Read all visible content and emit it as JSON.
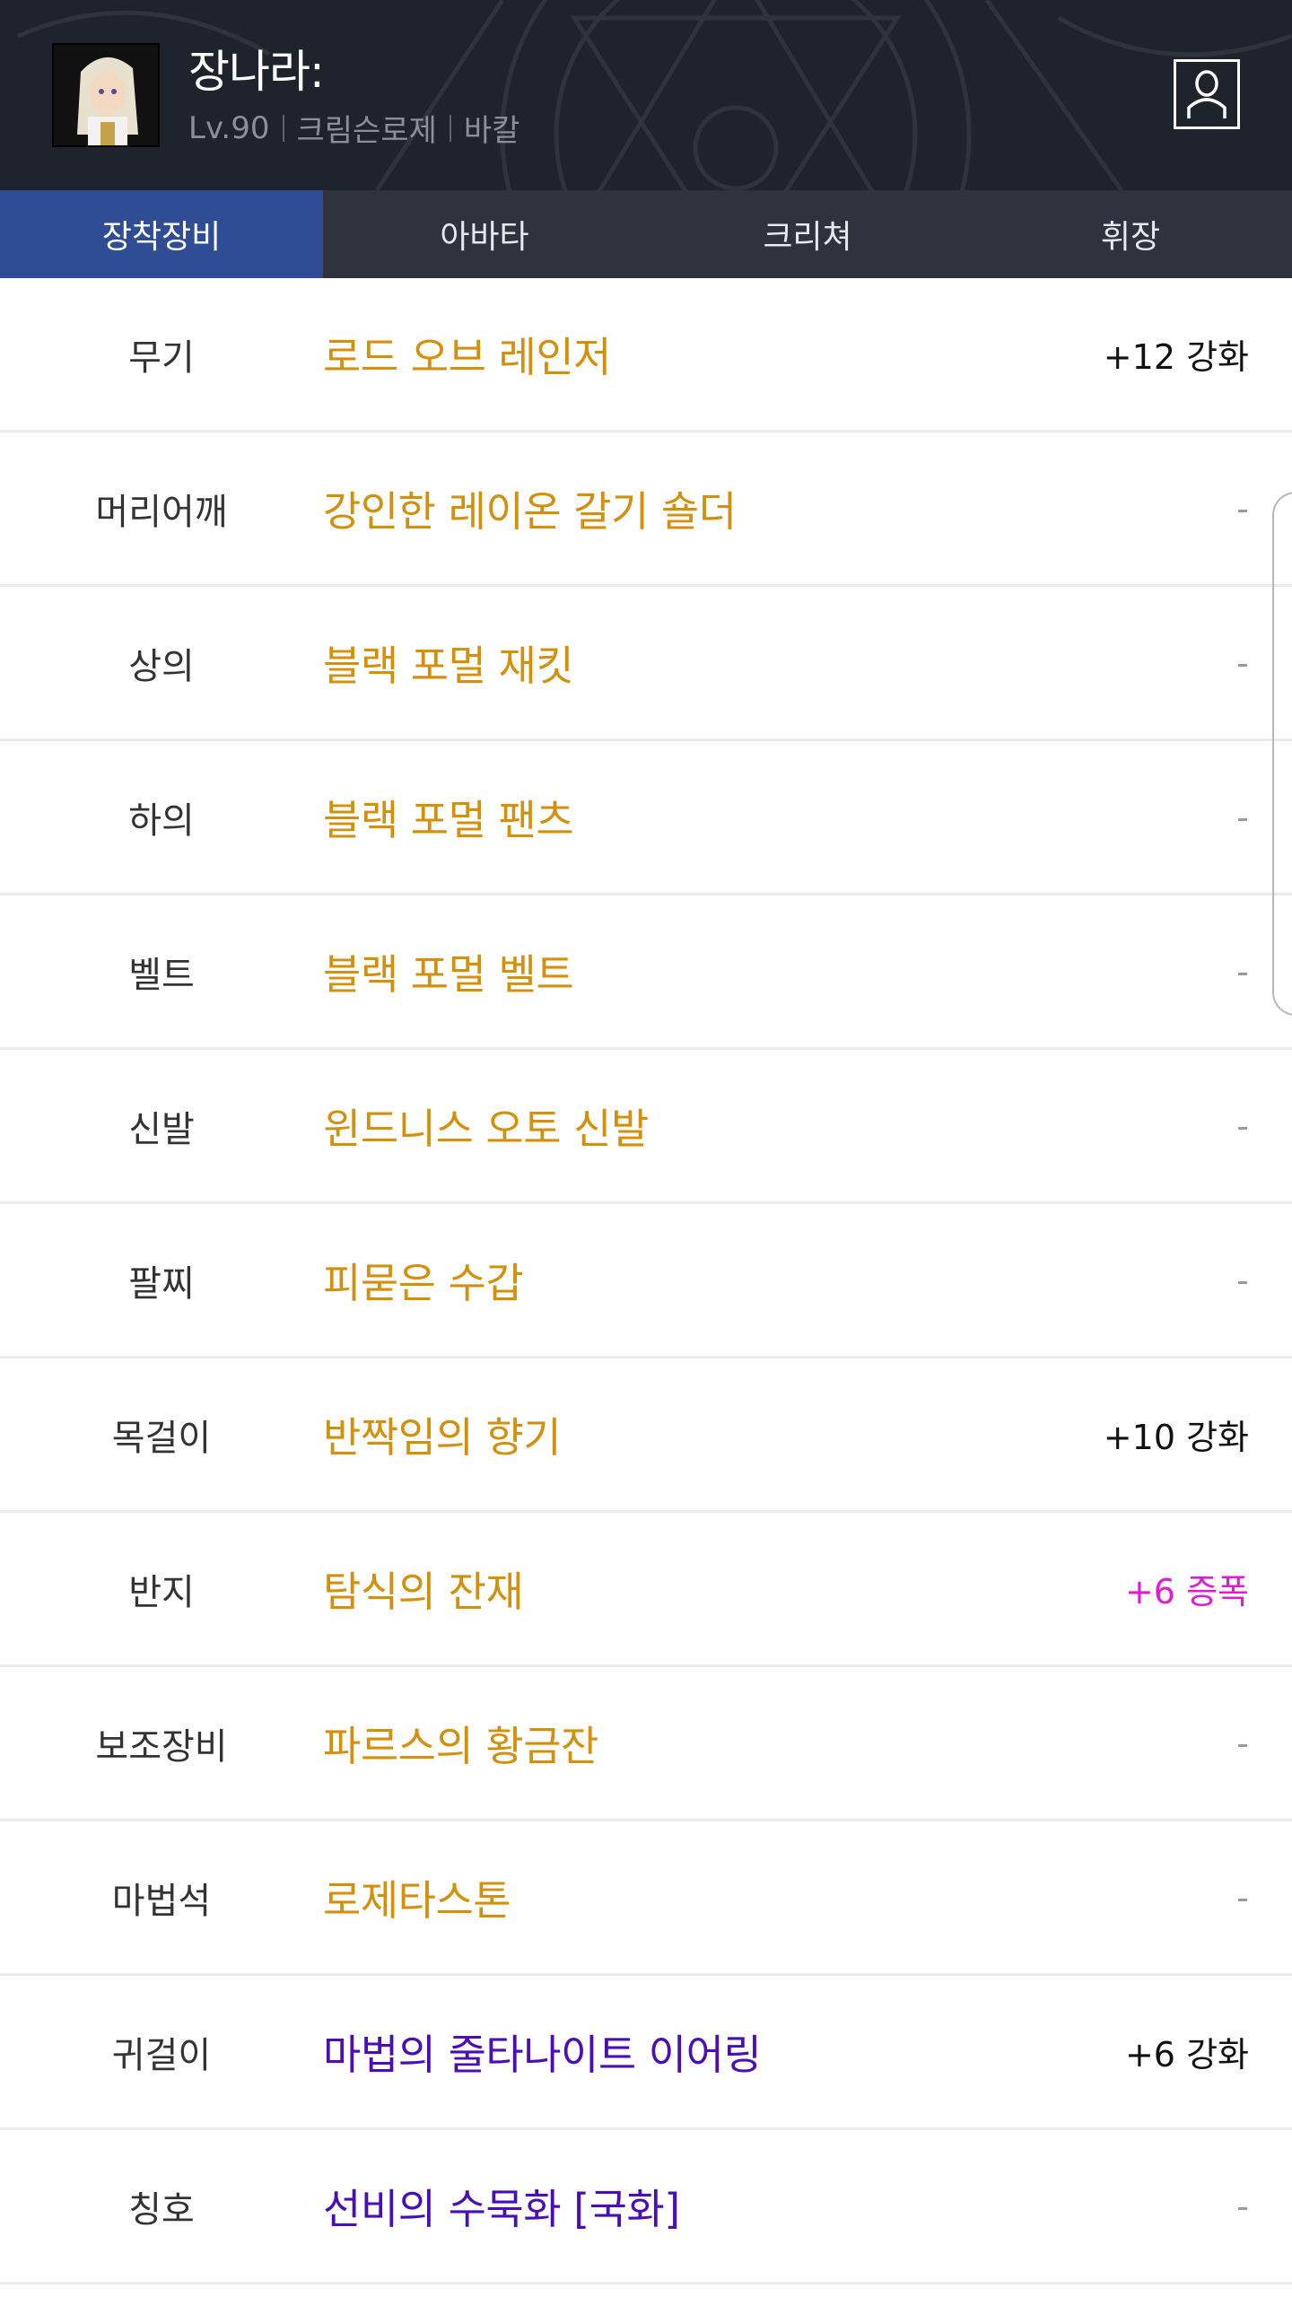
{
  "header": {
    "character_name": "장나라:",
    "level": "Lv.90",
    "job": "크림슨로제",
    "server": "바칼",
    "profile_icon": "person-icon"
  },
  "tabs": [
    {
      "label": "장착장비",
      "active": true
    },
    {
      "label": "아바타",
      "active": false
    },
    {
      "label": "크리쳐",
      "active": false
    },
    {
      "label": "휘장",
      "active": false
    }
  ],
  "colors": {
    "header_bg": "#1f232b",
    "tab_bar": "#2e333e",
    "tab_active": "#2f4d95",
    "item_gold": "#d4900c",
    "item_purple": "#4a0eb8",
    "amplify_pink": "#e01bd6"
  },
  "equipment": [
    {
      "slot": "무기",
      "item": "로드 오브 레인저",
      "upgrade": "+12 강화"
    },
    {
      "slot": "머리어깨",
      "item": "강인한 레이온 갈기 숄더",
      "upgrade": "-"
    },
    {
      "slot": "상의",
      "item": "블랙 포멀 재킷",
      "upgrade": "-"
    },
    {
      "slot": "하의",
      "item": "블랙 포멀 팬츠",
      "upgrade": "-"
    },
    {
      "slot": "벨트",
      "item": "블랙 포멀 벨트",
      "upgrade": "-"
    },
    {
      "slot": "신발",
      "item": "윈드니스 오토 신발",
      "upgrade": "-"
    },
    {
      "slot": "팔찌",
      "item": "피묻은 수갑",
      "upgrade": "-"
    },
    {
      "slot": "목걸이",
      "item": "반짝임의 향기",
      "upgrade": "+10 강화"
    },
    {
      "slot": "반지",
      "item": "탐식의 잔재",
      "upgrade": "+6 증폭"
    },
    {
      "slot": "보조장비",
      "item": "파르스의 황금잔",
      "upgrade": "-"
    },
    {
      "slot": "마법석",
      "item": "로제타스톤",
      "upgrade": "-"
    },
    {
      "slot": "귀걸이",
      "item": "마법의 줄타나이트 이어링",
      "upgrade": "+6 강화"
    },
    {
      "slot": "칭호",
      "item": "선비의 수묵화 [국화]",
      "upgrade": "-"
    }
  ]
}
